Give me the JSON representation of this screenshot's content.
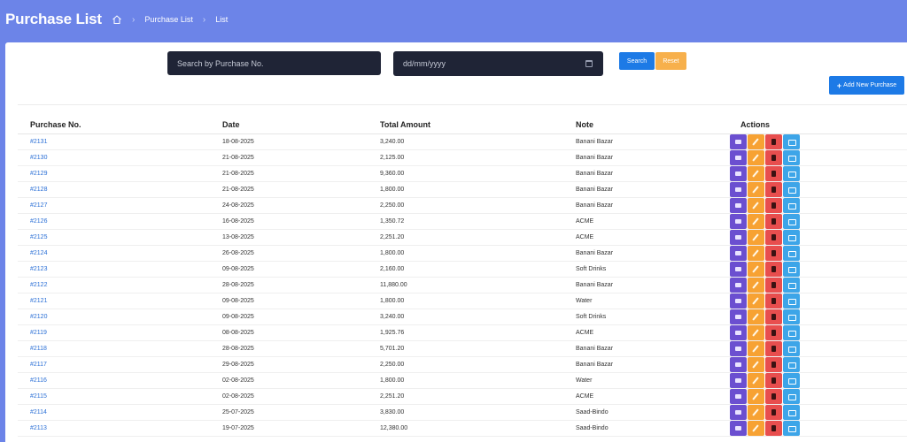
{
  "header": {
    "title": "Purchase List",
    "breadcrumb": [
      "Purchase List",
      "List"
    ]
  },
  "filters": {
    "search_placeholder": "Search by Purchase No.",
    "date_placeholder": "dd/mm/yyyy",
    "search_label": "Search",
    "reset_label": "Reset",
    "add_label": "Add New Purchase"
  },
  "table": {
    "headers": [
      "Purchase No.",
      "Date",
      "Total Amount",
      "Note",
      "Actions"
    ],
    "rows": [
      {
        "no": "#2131",
        "date": "18-08-2025",
        "amount": "3,240.00",
        "note": "Banani Bazar"
      },
      {
        "no": "#2130",
        "date": "21-08-2025",
        "amount": "2,125.00",
        "note": "Banani Bazar"
      },
      {
        "no": "#2129",
        "date": "21-08-2025",
        "amount": "9,360.00",
        "note": "Banani Bazar"
      },
      {
        "no": "#2128",
        "date": "21-08-2025",
        "amount": "1,800.00",
        "note": "Banani Bazar"
      },
      {
        "no": "#2127",
        "date": "24-08-2025",
        "amount": "2,250.00",
        "note": "Banani Bazar"
      },
      {
        "no": "#2126",
        "date": "16-08-2025",
        "amount": "1,350.72",
        "note": "ACME"
      },
      {
        "no": "#2125",
        "date": "13-08-2025",
        "amount": "2,251.20",
        "note": "ACME"
      },
      {
        "no": "#2124",
        "date": "26-08-2025",
        "amount": "1,800.00",
        "note": "Banani Bazar"
      },
      {
        "no": "#2123",
        "date": "09-08-2025",
        "amount": "2,160.00",
        "note": "Soft Drinks"
      },
      {
        "no": "#2122",
        "date": "28-08-2025",
        "amount": "11,880.00",
        "note": "Banani Bazar"
      },
      {
        "no": "#2121",
        "date": "09-08-2025",
        "amount": "1,800.00",
        "note": "Water"
      },
      {
        "no": "#2120",
        "date": "09-08-2025",
        "amount": "3,240.00",
        "note": "Soft Drinks"
      },
      {
        "no": "#2119",
        "date": "08-08-2025",
        "amount": "1,925.76",
        "note": "ACME"
      },
      {
        "no": "#2118",
        "date": "28-08-2025",
        "amount": "5,701.20",
        "note": "Banani Bazar"
      },
      {
        "no": "#2117",
        "date": "29-08-2025",
        "amount": "2,250.00",
        "note": "Banani Bazar"
      },
      {
        "no": "#2116",
        "date": "02-08-2025",
        "amount": "1,800.00",
        "note": "Water"
      },
      {
        "no": "#2115",
        "date": "02-08-2025",
        "amount": "2,251.20",
        "note": "ACME"
      },
      {
        "no": "#2114",
        "date": "25-07-2025",
        "amount": "3,830.00",
        "note": "Saad-Bindo"
      },
      {
        "no": "#2113",
        "date": "19-07-2025",
        "amount": "12,380.00",
        "note": "Saad-Bindo"
      }
    ]
  },
  "colors": {
    "header_bg": "#6c84e8",
    "view": "#6b4fd0",
    "edit": "#f7a233",
    "delete": "#e84e4e",
    "print": "#3da5e8",
    "primary": "#1d7ae6"
  }
}
